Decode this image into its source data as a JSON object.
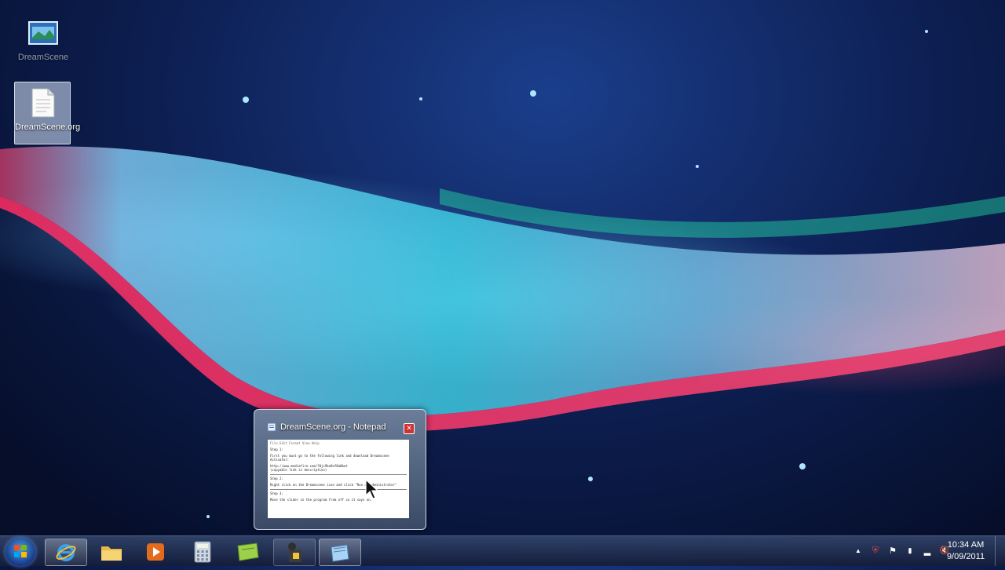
{
  "desktop": {
    "icons": [
      {
        "label": "DreamScene",
        "icon": "dreamscene-film-icon"
      },
      {
        "label": "DreamScene.org",
        "icon": "text-document-icon",
        "selected": true
      }
    ]
  },
  "notepad_preview": {
    "title": "DreamScene.org - Notepad",
    "close_glyph": "✕",
    "content": {
      "menu": "File  Edit  Format  View  Help",
      "step1_heading": "Step 1:",
      "step1_text": "First you must go to the following link and download Dreamscene Activator:",
      "step1_link": "http://www.mediafire.com/?0jc9ke8nf8a8bat",
      "step1_note": "(copyable link in description)",
      "step2_heading": "Step 2:",
      "step2_text": "Right click on the Dreamscene icon and click \"Run as administrator\"",
      "step3_heading": "Step 3:",
      "step3_text": "Move the slider in the program from off so it says on."
    }
  },
  "taskbar": {
    "pinned": [
      {
        "name": "internet-explorer",
        "icon": "internet-explorer-icon",
        "state": "active"
      },
      {
        "name": "windows-explorer",
        "icon": "folder-icon",
        "state": "none"
      },
      {
        "name": "media-player",
        "icon": "media-player-icon",
        "state": "none"
      },
      {
        "name": "calculator",
        "icon": "calculator-icon",
        "state": "none"
      },
      {
        "name": "notes",
        "icon": "sticky-notes-icon",
        "state": "none"
      },
      {
        "name": "dreamscene-activator",
        "icon": "activator-icon",
        "state": "open"
      },
      {
        "name": "notepad",
        "icon": "notepad-icon",
        "state": "hover"
      }
    ],
    "tray": {
      "glyphs": [
        "▲",
        "⛨",
        "⚑",
        "▮",
        "▂",
        "🔇"
      ]
    },
    "clock": {
      "time": "10:34 AM",
      "date": "9/09/2011"
    }
  }
}
